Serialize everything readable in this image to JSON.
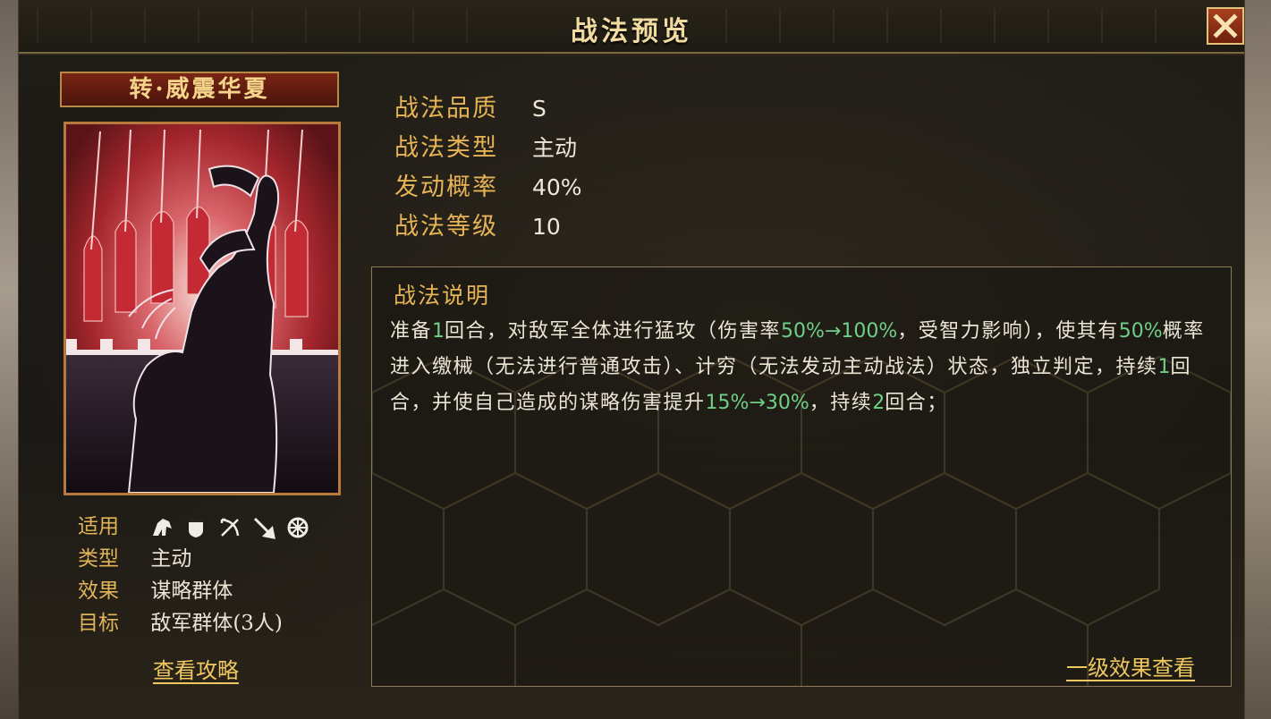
{
  "window": {
    "title": "战法预览"
  },
  "skill": {
    "name": "转·威震华夏",
    "attributes": [
      {
        "key": "适用",
        "value": ""
      },
      {
        "key": "类型",
        "value": "主动"
      },
      {
        "key": "效果",
        "value": "谋略群体"
      },
      {
        "key": "目标",
        "value": "敌军群体(3人)"
      }
    ],
    "unit_icons": [
      "cavalry-icon",
      "shield-icon",
      "bow-icon",
      "spear-icon",
      "wheel-icon"
    ],
    "guide_link": "查看攻略"
  },
  "stats": [
    {
      "key": "战法品质",
      "value": "S"
    },
    {
      "key": "战法类型",
      "value": "主动"
    },
    {
      "key": "发动概率",
      "value": "40%"
    },
    {
      "key": "战法等级",
      "value": "10"
    }
  ],
  "description": {
    "title": "战法说明",
    "parts": [
      {
        "t": "准备",
        "hl": false
      },
      {
        "t": "1",
        "hl": true
      },
      {
        "t": "回合，对敌军全体进行猛攻（伤害率",
        "hl": false
      },
      {
        "t": "50%→100%",
        "hl": true
      },
      {
        "t": "，受智力影响），使其有",
        "hl": false
      },
      {
        "t": "50%",
        "hl": true
      },
      {
        "t": "概率进入缴械（无法进行普通攻击）、计穷（无法发动主动战法）状态，独立判定，持续",
        "hl": false
      },
      {
        "t": "1",
        "hl": true
      },
      {
        "t": "回合，并使自己造成的谋略伤害提升",
        "hl": false
      },
      {
        "t": "15%→30%",
        "hl": true
      },
      {
        "t": "，持续",
        "hl": false
      },
      {
        "t": "2",
        "hl": true
      },
      {
        "t": "回合；",
        "hl": false
      }
    ],
    "level_link": "一级效果查看"
  },
  "colors": {
    "gold_label": "#e6b454",
    "highlight_green": "#6fcf86",
    "text": "#ece5d6",
    "accent_red": "#7a2514"
  }
}
